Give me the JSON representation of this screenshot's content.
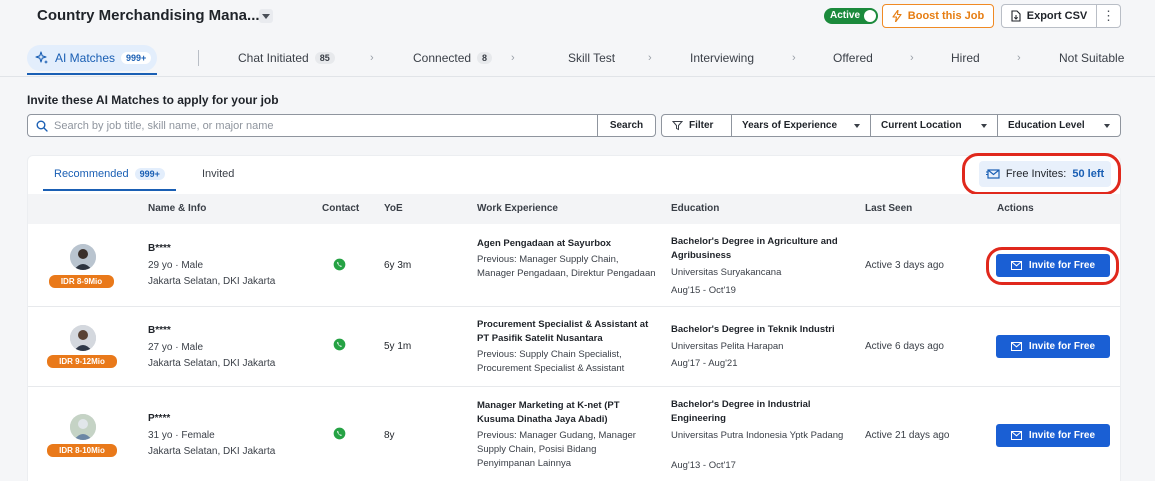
{
  "header": {
    "job_title": "Country Merchandising Mana...",
    "status_label": "Active",
    "boost_label": "Boost this Job",
    "export_label": "Export CSV",
    "more_label": "⋮"
  },
  "pipeline": {
    "ai_matches": {
      "label": "AI Matches",
      "count": "999+"
    },
    "tabs": [
      {
        "label": "Chat Initiated",
        "count": "85"
      },
      {
        "label": "Connected",
        "count": "8"
      },
      {
        "label": "Skill Test",
        "count": ""
      },
      {
        "label": "Interviewing",
        "count": ""
      },
      {
        "label": "Offered",
        "count": ""
      },
      {
        "label": "Hired",
        "count": ""
      },
      {
        "label": "Not Suitable",
        "count": ""
      }
    ],
    "arrow": "›"
  },
  "invite_heading": "Invite these AI Matches to apply for your job",
  "search": {
    "placeholder": "Search by job title, skill name, or major name",
    "value": "",
    "button_label": "Search"
  },
  "filters": {
    "filter_label": "Filter",
    "years_label": "Years of Experience",
    "location_label": "Current Location",
    "education_label": "Education Level"
  },
  "list_tabs": {
    "recommended": {
      "label": "Recommended",
      "count": "999+"
    },
    "invited": {
      "label": "Invited"
    }
  },
  "free_invites": {
    "label": "Free Invites:",
    "value": "50 left"
  },
  "columns": {
    "name_info": "Name & Info",
    "contact": "Contact",
    "yoe": "YoE",
    "work": "Work Experience",
    "education": "Education",
    "last_seen": "Last Seen",
    "actions": "Actions"
  },
  "candidates": [
    {
      "salary": "IDR 8-9Mio",
      "name": "B****",
      "age_gender": "29 yo · Male",
      "location": "Jakarta Selatan, DKI Jakarta",
      "yoe": "6y 3m",
      "work_title": "Agen Pengadaan at Sayurbox",
      "work_prev": "Previous: Manager Supply Chain, Manager Pengadaan, Direktur Pengadaan",
      "edu_title": "Bachelor's Degree in Agriculture and Agribusiness",
      "edu_school": "Universitas Suryakancana",
      "edu_period": "Aug'15 - Oct'19",
      "last_seen": "Active 3 days ago",
      "invite_label": "Invite for Free"
    },
    {
      "salary": "IDR 9-12Mio",
      "name": "B****",
      "age_gender": "27 yo · Male",
      "location": "Jakarta Selatan, DKI Jakarta",
      "yoe": "5y 1m",
      "work_title": "Procurement Specialist & Assistant at PT Pasifik Satelit Nusantara",
      "work_prev": "Previous: Supply Chain Specialist, Procurement Specialist & Assistant",
      "edu_title": "Bachelor's Degree in Teknik Industri",
      "edu_school": "Universitas Pelita Harapan",
      "edu_period": "Aug'17 - Aug'21",
      "last_seen": "Active 6 days ago",
      "invite_label": "Invite for Free"
    },
    {
      "salary": "IDR 8-10Mio",
      "name": "P****",
      "age_gender": "31 yo · Female",
      "location": "Jakarta Selatan, DKI Jakarta",
      "yoe": "8y",
      "work_title": "Manager Marketing at K-net (PT Kusuma Dinatha Jaya Abadi)",
      "work_prev": "Previous: Manager Gudang, Manager Supply Chain, Posisi Bidang Penyimpanan Lainnya",
      "edu_title": "Bachelor's Degree in Industrial Engineering",
      "edu_school": "Universitas Putra Indonesia Yptk Padang",
      "edu_period": "Aug'13 - Oct'17",
      "last_seen": "Active 21 days ago",
      "invite_label": "Invite for Free"
    }
  ],
  "colors": {
    "brand_blue": "#1a5fd4",
    "active_green": "#1b8a3c",
    "boost_orange": "#e67d12",
    "salary_orange": "#e9791a",
    "highlight_red": "#e0281c",
    "whatsapp_green": "#25a244"
  },
  "icons": {
    "sparkle": "sparkle-icon",
    "bolt": "bolt-icon",
    "export": "export-file-icon",
    "search": "search-icon",
    "filter": "filter-icon",
    "envelope": "envelope-icon",
    "whatsapp": "whatsapp-icon"
  }
}
